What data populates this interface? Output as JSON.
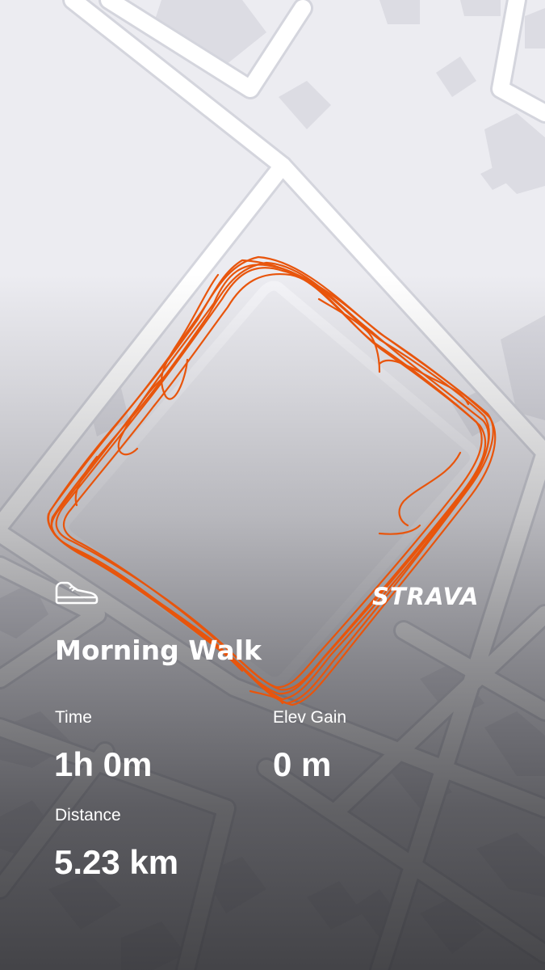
{
  "activity": {
    "title": "Morning Walk",
    "type_icon": "shoe-icon",
    "brand": "STRAVA"
  },
  "stats": {
    "time_label": "Time",
    "time_value": "1h 0m",
    "elev_label": "Elev Gain",
    "elev_value": "0 m",
    "distance_label": "Distance",
    "distance_value": "5.23 km"
  },
  "colors": {
    "route": "#e8550c",
    "text": "#ffffff",
    "map_bg": "#ececf1",
    "road": "#ffffff",
    "building": "#dcdce3"
  }
}
